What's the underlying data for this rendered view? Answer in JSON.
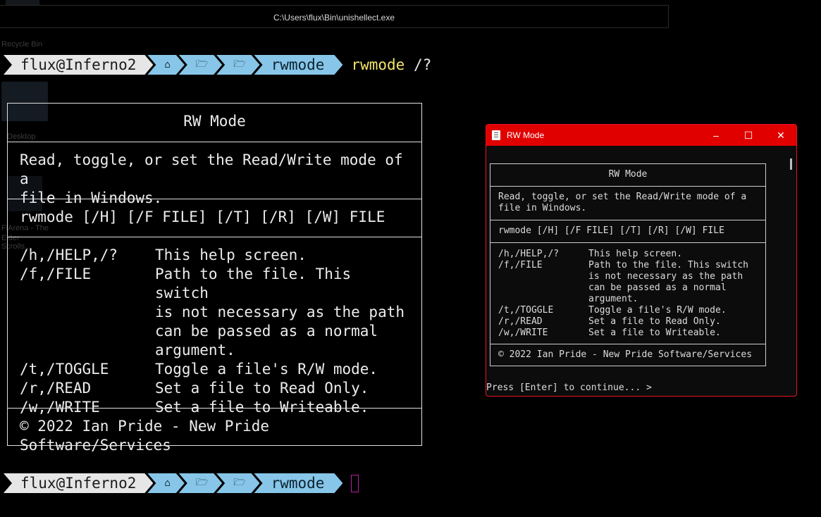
{
  "terminal": {
    "window_title": "C:\\Users\\flux\\Bin\\unishellect.exe",
    "prompt": {
      "user_host": "flux@Inferno2",
      "home_icon": "home-icon",
      "folder_icon": "folder-icon",
      "folder_name": "rwmode"
    },
    "command": {
      "name": "rwmode",
      "args": "/?"
    }
  },
  "desktop": {
    "icons": [
      {
        "label": "Recycle Bin",
        "icon": "recycle-bin-icon"
      },
      {
        "label": "Desktop",
        "icon": "monitor-icon"
      },
      {
        "label": "FiArena - The",
        "label2": "Elder Scrolls...",
        "icon": "shortcut-icon"
      }
    ]
  },
  "help": {
    "title": "RW Mode",
    "description": "Read, toggle, or set the Read/Write mode of a file in Windows.",
    "desc_line1": "Read, toggle, or set the Read/Write mode of a",
    "desc_line2": "file in Windows.",
    "usage": "rwmode [/H] [/F FILE] [/T] [/R] [/W] FILE",
    "options": [
      {
        "switch": "/h,/HELP,/?",
        "lines": [
          "This help screen."
        ]
      },
      {
        "switch": "/f,/FILE",
        "lines": [
          "Path to the file. This switch",
          "is not necessary as the path",
          "can be passed as a normal",
          "argument."
        ]
      },
      {
        "switch": "/t,/TOGGLE",
        "lines": [
          "Toggle a file's R/W mode."
        ]
      },
      {
        "switch": "/r,/READ",
        "lines": [
          "Set a file to Read Only."
        ]
      },
      {
        "switch": "/w,/WRITE",
        "lines": [
          "Set a file to Writeable."
        ]
      }
    ],
    "copyright": "© 2022 Ian Pride - New Pride Software/Services"
  },
  "popup": {
    "title": "RW Mode",
    "minimize": "–",
    "maximize": "☐",
    "close": "✕",
    "accent": "#e00000",
    "continue_prompt": "Press [Enter] to continue... >"
  },
  "colors": {
    "prompt_user_bg": "#e6e6e6",
    "prompt_path_bg": "#87c6e8",
    "command_name": "#f2e36b",
    "cursor": "#b6209f"
  }
}
